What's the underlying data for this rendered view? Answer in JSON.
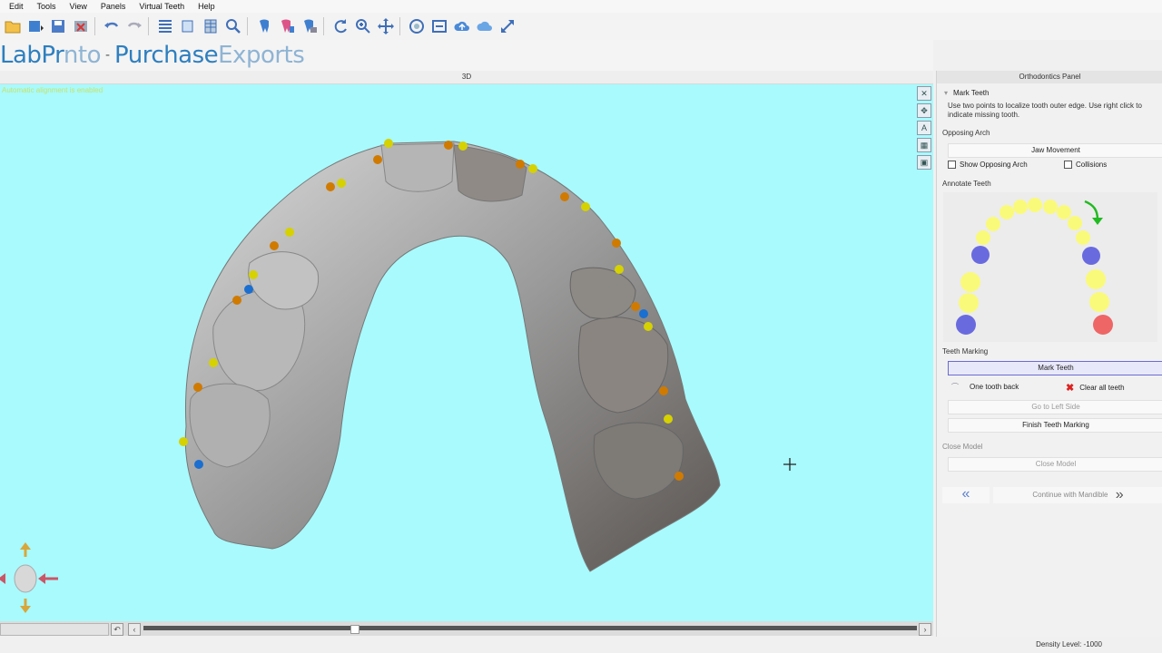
{
  "menu": [
    "Edit",
    "Tools",
    "View",
    "Panels",
    "Virtual Teeth",
    "Help"
  ],
  "toolbar": {
    "icons": [
      "open-icon",
      "export-icon",
      "save-icon",
      "delete-icon",
      "undo-icon",
      "redo-icon",
      "grid-icon",
      "layers-icon",
      "table-icon",
      "zoom-search-icon",
      "tooth-icon",
      "tooth-color-icon",
      "tooth-select-icon",
      "refresh-icon",
      "zoom-icon",
      "pan-icon",
      "rotate-icon",
      "fit-icon",
      "upload-cloud-icon",
      "cloud-icon",
      "expand-icon"
    ]
  },
  "brand": {
    "left_a": "LabPr",
    "left_b": "nto",
    "dash": "-",
    "right_a": "Purchase",
    "right_b": "Exports"
  },
  "viewport": {
    "tab_label": "3D",
    "status_text": "Automatic alignment is enabled"
  },
  "panel": {
    "title": "Orthodontics Panel",
    "mark_teeth_header": "Mark Teeth",
    "mark_teeth_hint": "Use two points to localize tooth outer edge. Use right click to indicate missing tooth.",
    "opposing_arch_header": "Opposing Arch",
    "jaw_movement_label": "Jaw Movement",
    "show_opposing_label": "Show Opposing Arch",
    "collisions_label": "Collisions",
    "annotate_header": "Annotate Teeth",
    "teeth_marking_header": "Teeth Marking",
    "mark_teeth_button": "Mark Teeth",
    "one_tooth_back_label": "One tooth back",
    "clear_all_label": "Clear all teeth",
    "go_left_label": "Go to Left Side",
    "finish_label": "Finish Teeth Marking",
    "close_model_header": "Close Model",
    "close_model_label": "Close Model",
    "continue_label": "Continue with Mandible"
  },
  "status": {
    "density": "Density Level: -1000"
  },
  "colors": {
    "viewport_bg": "#a8fafd",
    "tooth_marked": "#fafa7a",
    "tooth_missing": "#6666dd",
    "tooth_current": "#ee6666",
    "arrow": "#22bb22",
    "brand": "#2e7fbf"
  }
}
